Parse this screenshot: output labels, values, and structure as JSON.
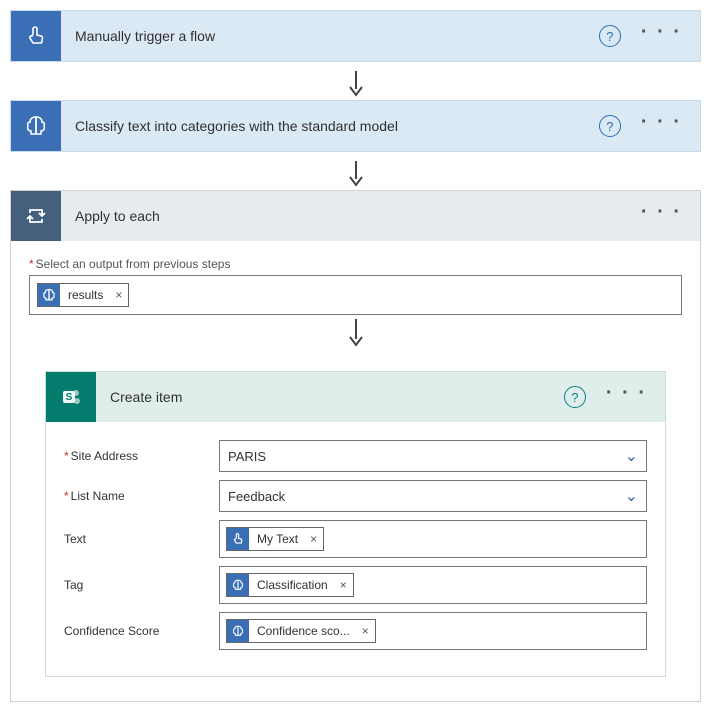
{
  "steps": {
    "trigger": {
      "title": "Manually trigger a flow"
    },
    "classify": {
      "title": "Classify text into categories with the standard model"
    },
    "apply": {
      "title": "Apply to each",
      "select_label": "Select an output from previous steps",
      "token": "results"
    },
    "create": {
      "title": "Create item",
      "fields": {
        "site_address": {
          "label": "Site Address",
          "value": "PARIS"
        },
        "list_name": {
          "label": "List Name",
          "value": "Feedback"
        },
        "text": {
          "label": "Text",
          "token": "My Text"
        },
        "tag": {
          "label": "Tag",
          "token": "Classification"
        },
        "confidence": {
          "label": "Confidence Score",
          "token": "Confidence sco..."
        }
      }
    }
  },
  "glyphs": {
    "help": "?",
    "close": "×",
    "ellipsis": "· · ·"
  }
}
